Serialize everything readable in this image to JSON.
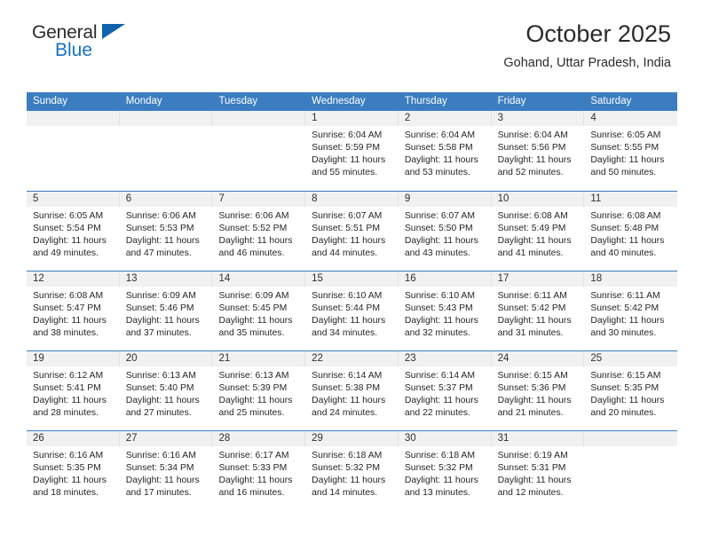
{
  "brand": {
    "name_top": "General",
    "name_bottom": "Blue",
    "flag_icon": "triangle-flag-icon",
    "color_dark": "#2b2b2b",
    "color_blue": "#1573c6",
    "flag_color": "#0f62ab"
  },
  "header": {
    "title": "October 2025",
    "subtitle": "Gohand, Uttar Pradesh, India"
  },
  "theme": {
    "header_bg": "#3b7dc0",
    "header_text": "#ffffff",
    "day_band_bg": "#f1f1f1",
    "row_divider": "#3b7dc0",
    "cell_text": "#262626"
  },
  "weekdays": [
    "Sunday",
    "Monday",
    "Tuesday",
    "Wednesday",
    "Thursday",
    "Friday",
    "Saturday"
  ],
  "weeks": [
    [
      {
        "day": "",
        "empty": true
      },
      {
        "day": "",
        "empty": true
      },
      {
        "day": "",
        "empty": true
      },
      {
        "day": "1",
        "sunrise": "Sunrise: 6:04 AM",
        "sunset": "Sunset: 5:59 PM",
        "daylight": "Daylight: 11 hours and 55 minutes."
      },
      {
        "day": "2",
        "sunrise": "Sunrise: 6:04 AM",
        "sunset": "Sunset: 5:58 PM",
        "daylight": "Daylight: 11 hours and 53 minutes."
      },
      {
        "day": "3",
        "sunrise": "Sunrise: 6:04 AM",
        "sunset": "Sunset: 5:56 PM",
        "daylight": "Daylight: 11 hours and 52 minutes."
      },
      {
        "day": "4",
        "sunrise": "Sunrise: 6:05 AM",
        "sunset": "Sunset: 5:55 PM",
        "daylight": "Daylight: 11 hours and 50 minutes."
      }
    ],
    [
      {
        "day": "5",
        "sunrise": "Sunrise: 6:05 AM",
        "sunset": "Sunset: 5:54 PM",
        "daylight": "Daylight: 11 hours and 49 minutes."
      },
      {
        "day": "6",
        "sunrise": "Sunrise: 6:06 AM",
        "sunset": "Sunset: 5:53 PM",
        "daylight": "Daylight: 11 hours and 47 minutes."
      },
      {
        "day": "7",
        "sunrise": "Sunrise: 6:06 AM",
        "sunset": "Sunset: 5:52 PM",
        "daylight": "Daylight: 11 hours and 46 minutes."
      },
      {
        "day": "8",
        "sunrise": "Sunrise: 6:07 AM",
        "sunset": "Sunset: 5:51 PM",
        "daylight": "Daylight: 11 hours and 44 minutes."
      },
      {
        "day": "9",
        "sunrise": "Sunrise: 6:07 AM",
        "sunset": "Sunset: 5:50 PM",
        "daylight": "Daylight: 11 hours and 43 minutes."
      },
      {
        "day": "10",
        "sunrise": "Sunrise: 6:08 AM",
        "sunset": "Sunset: 5:49 PM",
        "daylight": "Daylight: 11 hours and 41 minutes."
      },
      {
        "day": "11",
        "sunrise": "Sunrise: 6:08 AM",
        "sunset": "Sunset: 5:48 PM",
        "daylight": "Daylight: 11 hours and 40 minutes."
      }
    ],
    [
      {
        "day": "12",
        "sunrise": "Sunrise: 6:08 AM",
        "sunset": "Sunset: 5:47 PM",
        "daylight": "Daylight: 11 hours and 38 minutes."
      },
      {
        "day": "13",
        "sunrise": "Sunrise: 6:09 AM",
        "sunset": "Sunset: 5:46 PM",
        "daylight": "Daylight: 11 hours and 37 minutes."
      },
      {
        "day": "14",
        "sunrise": "Sunrise: 6:09 AM",
        "sunset": "Sunset: 5:45 PM",
        "daylight": "Daylight: 11 hours and 35 minutes."
      },
      {
        "day": "15",
        "sunrise": "Sunrise: 6:10 AM",
        "sunset": "Sunset: 5:44 PM",
        "daylight": "Daylight: 11 hours and 34 minutes."
      },
      {
        "day": "16",
        "sunrise": "Sunrise: 6:10 AM",
        "sunset": "Sunset: 5:43 PM",
        "daylight": "Daylight: 11 hours and 32 minutes."
      },
      {
        "day": "17",
        "sunrise": "Sunrise: 6:11 AM",
        "sunset": "Sunset: 5:42 PM",
        "daylight": "Daylight: 11 hours and 31 minutes."
      },
      {
        "day": "18",
        "sunrise": "Sunrise: 6:11 AM",
        "sunset": "Sunset: 5:42 PM",
        "daylight": "Daylight: 11 hours and 30 minutes."
      }
    ],
    [
      {
        "day": "19",
        "sunrise": "Sunrise: 6:12 AM",
        "sunset": "Sunset: 5:41 PM",
        "daylight": "Daylight: 11 hours and 28 minutes."
      },
      {
        "day": "20",
        "sunrise": "Sunrise: 6:13 AM",
        "sunset": "Sunset: 5:40 PM",
        "daylight": "Daylight: 11 hours and 27 minutes."
      },
      {
        "day": "21",
        "sunrise": "Sunrise: 6:13 AM",
        "sunset": "Sunset: 5:39 PM",
        "daylight": "Daylight: 11 hours and 25 minutes."
      },
      {
        "day": "22",
        "sunrise": "Sunrise: 6:14 AM",
        "sunset": "Sunset: 5:38 PM",
        "daylight": "Daylight: 11 hours and 24 minutes."
      },
      {
        "day": "23",
        "sunrise": "Sunrise: 6:14 AM",
        "sunset": "Sunset: 5:37 PM",
        "daylight": "Daylight: 11 hours and 22 minutes."
      },
      {
        "day": "24",
        "sunrise": "Sunrise: 6:15 AM",
        "sunset": "Sunset: 5:36 PM",
        "daylight": "Daylight: 11 hours and 21 minutes."
      },
      {
        "day": "25",
        "sunrise": "Sunrise: 6:15 AM",
        "sunset": "Sunset: 5:35 PM",
        "daylight": "Daylight: 11 hours and 20 minutes."
      }
    ],
    [
      {
        "day": "26",
        "sunrise": "Sunrise: 6:16 AM",
        "sunset": "Sunset: 5:35 PM",
        "daylight": "Daylight: 11 hours and 18 minutes."
      },
      {
        "day": "27",
        "sunrise": "Sunrise: 6:16 AM",
        "sunset": "Sunset: 5:34 PM",
        "daylight": "Daylight: 11 hours and 17 minutes."
      },
      {
        "day": "28",
        "sunrise": "Sunrise: 6:17 AM",
        "sunset": "Sunset: 5:33 PM",
        "daylight": "Daylight: 11 hours and 16 minutes."
      },
      {
        "day": "29",
        "sunrise": "Sunrise: 6:18 AM",
        "sunset": "Sunset: 5:32 PM",
        "daylight": "Daylight: 11 hours and 14 minutes."
      },
      {
        "day": "30",
        "sunrise": "Sunrise: 6:18 AM",
        "sunset": "Sunset: 5:32 PM",
        "daylight": "Daylight: 11 hours and 13 minutes."
      },
      {
        "day": "31",
        "sunrise": "Sunrise: 6:19 AM",
        "sunset": "Sunset: 5:31 PM",
        "daylight": "Daylight: 11 hours and 12 minutes."
      },
      {
        "day": "",
        "empty": true
      }
    ]
  ]
}
